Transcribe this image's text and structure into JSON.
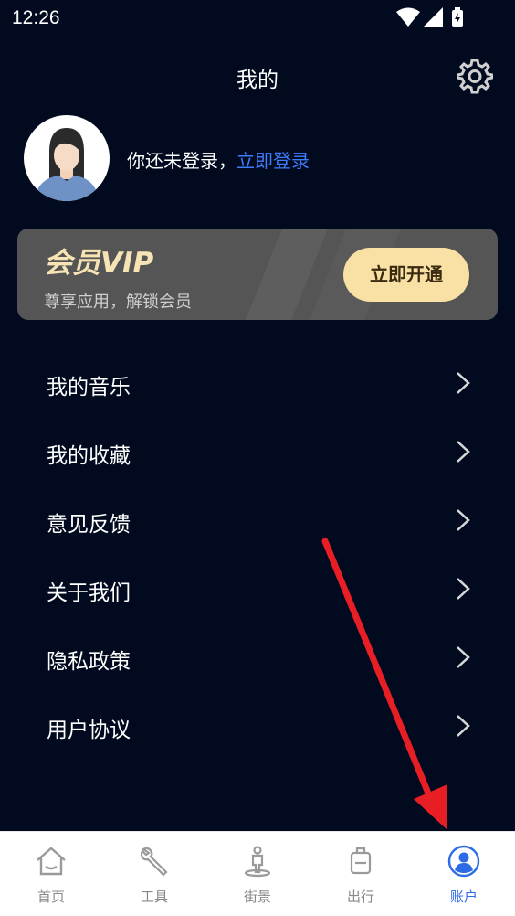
{
  "status_bar": {
    "time": "12:26"
  },
  "header": {
    "title": "我的"
  },
  "profile": {
    "login_prompt": "你还未登录，",
    "login_link": "立即登录"
  },
  "vip": {
    "title": "会员VIP",
    "subtitle": "尊享应用，解锁会员",
    "button": "立即开通",
    "accent": "#f9e1a6"
  },
  "menu": {
    "items": [
      {
        "label": "我的音乐"
      },
      {
        "label": "我的收藏"
      },
      {
        "label": "意见反馈"
      },
      {
        "label": "关于我们"
      },
      {
        "label": "隐私政策"
      },
      {
        "label": "用户协议"
      }
    ]
  },
  "tabbar": {
    "tabs": [
      {
        "label": "首页",
        "icon": "home-icon"
      },
      {
        "label": "工具",
        "icon": "wrench-icon"
      },
      {
        "label": "街景",
        "icon": "street-view-icon"
      },
      {
        "label": "出行",
        "icon": "luggage-icon"
      },
      {
        "label": "账户",
        "icon": "user-icon"
      }
    ],
    "active": "账户",
    "active_color": "#2d6be6"
  },
  "colors": {
    "background": "#020a1f",
    "link": "#3d7dff",
    "arrow": "#e81e25"
  }
}
